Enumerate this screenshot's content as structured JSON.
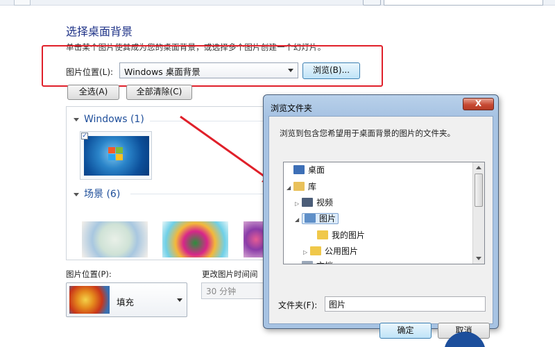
{
  "page": {
    "title": "选择桌面背景",
    "description": "单击某个图片使其成为您的桌面背景，或选择多个图片创建一个幻灯片。"
  },
  "location": {
    "label": "图片位置(L):",
    "value": "Windows 桌面背景",
    "browse_label": "浏览(B)..."
  },
  "actions": {
    "select_all": "全选(A)",
    "clear_all": "全部清除(C)"
  },
  "gallery": {
    "groups": [
      {
        "label": "Windows (1)"
      },
      {
        "label": "场景 (6)"
      }
    ],
    "checked_mark": "✓"
  },
  "bottom": {
    "position_label": "图片位置(P):",
    "position_value": "填充",
    "interval_label": "更改图片时间间",
    "interval_value": "30 分钟"
  },
  "dialog": {
    "title": "浏览文件夹",
    "close_label": "X",
    "description": "浏览到包含您希望用于桌面背景的图片的文件夹。",
    "tree": [
      {
        "label": "桌面",
        "icon": "desktop-icon",
        "icon_color": "#3d6fb6"
      },
      {
        "label": "库",
        "icon": "library-icon",
        "icon_color": "#e9c15b"
      },
      {
        "label": "视频",
        "icon": "video-icon",
        "icon_color": "#4b5d78"
      },
      {
        "label": "图片",
        "icon": "pictures-icon",
        "icon_color": "#5f8fc8"
      },
      {
        "label": "我的图片",
        "icon": "folder-icon",
        "icon_color": "#f0c84a"
      },
      {
        "label": "公用图片",
        "icon": "folder-icon",
        "icon_color": "#f0c84a"
      },
      {
        "label": "文档",
        "icon": "documents-icon",
        "icon_color": "#9aa7b8"
      }
    ],
    "folder_label": "文件夹(F):",
    "folder_value": "图片",
    "ok_label": "确定",
    "cancel_label": "取消"
  },
  "colors": {
    "highlight_box": "#e0202a",
    "arrow": "#e0202a",
    "title_blue": "#1e3287"
  }
}
